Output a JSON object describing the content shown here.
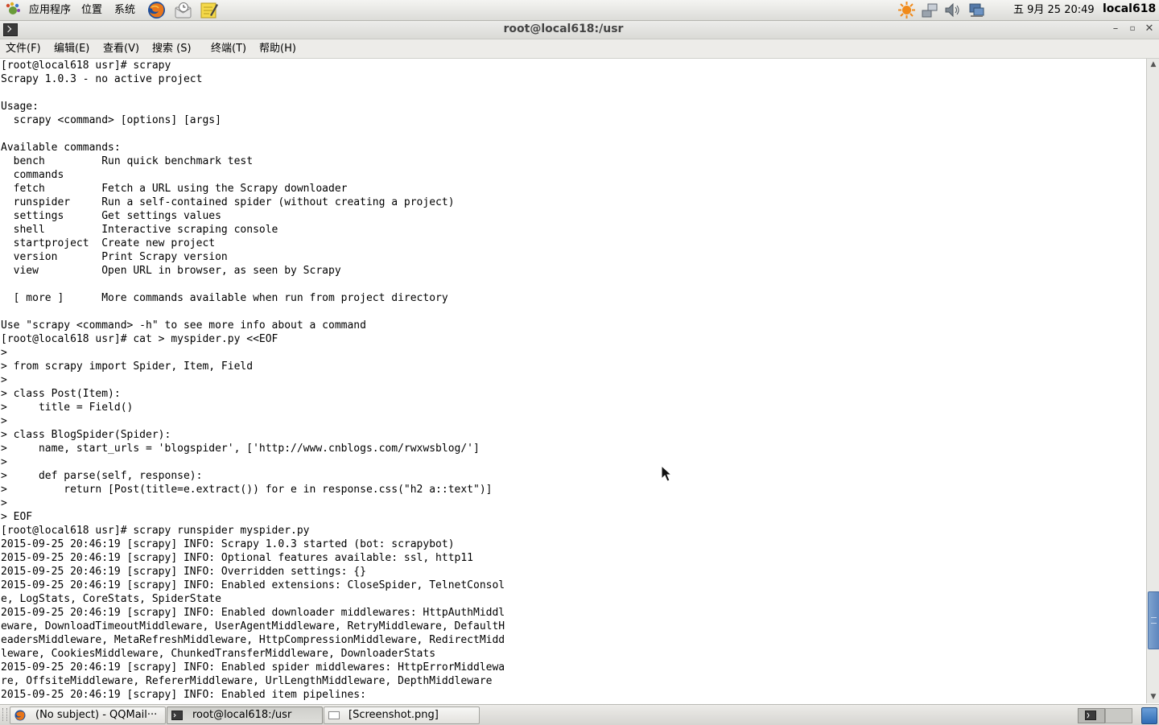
{
  "top_panel": {
    "menus": [
      "应用程序",
      "位置",
      "系统"
    ],
    "launchers": [
      "firefox-icon",
      "mail-clock-icon",
      "notes-icon"
    ],
    "tray_icons": [
      "update-icon",
      "network-icon",
      "volume-icon",
      "display-icon"
    ],
    "clock": "五 9月 25 20:49",
    "hostname": "local618"
  },
  "window": {
    "title": "root@local618:/usr",
    "menu": [
      "文件(F)",
      "编辑(E)",
      "查看(V)",
      "搜索 (S)",
      "终端(T)",
      "帮助(H)"
    ]
  },
  "terminal": {
    "lines": [
      "[root@local618 usr]# scrapy",
      "Scrapy 1.0.3 - no active project",
      "",
      "Usage:",
      "  scrapy <command> [options] [args]",
      "",
      "Available commands:",
      "  bench         Run quick benchmark test",
      "  commands",
      "  fetch         Fetch a URL using the Scrapy downloader",
      "  runspider     Run a self-contained spider (without creating a project)",
      "  settings      Get settings values",
      "  shell         Interactive scraping console",
      "  startproject  Create new project",
      "  version       Print Scrapy version",
      "  view          Open URL in browser, as seen by Scrapy",
      "",
      "  [ more ]      More commands available when run from project directory",
      "",
      "Use \"scrapy <command> -h\" to see more info about a command",
      "[root@local618 usr]# cat > myspider.py <<EOF",
      ">",
      "> from scrapy import Spider, Item, Field",
      ">",
      "> class Post(Item):",
      ">     title = Field()",
      ">",
      "> class BlogSpider(Spider):",
      ">     name, start_urls = 'blogspider', ['http://www.cnblogs.com/rwxwsblog/']",
      ">",
      ">     def parse(self, response):",
      ">         return [Post(title=e.extract()) for e in response.css(\"h2 a::text\")]",
      ">",
      "> EOF",
      "[root@local618 usr]# scrapy runspider myspider.py",
      "2015-09-25 20:46:19 [scrapy] INFO: Scrapy 1.0.3 started (bot: scrapybot)",
      "2015-09-25 20:46:19 [scrapy] INFO: Optional features available: ssl, http11",
      "2015-09-25 20:46:19 [scrapy] INFO: Overridden settings: {}",
      "2015-09-25 20:46:19 [scrapy] INFO: Enabled extensions: CloseSpider, TelnetConsol",
      "e, LogStats, CoreStats, SpiderState",
      "2015-09-25 20:46:19 [scrapy] INFO: Enabled downloader middlewares: HttpAuthMiddl",
      "eware, DownloadTimeoutMiddleware, UserAgentMiddleware, RetryMiddleware, DefaultH",
      "eadersMiddleware, MetaRefreshMiddleware, HttpCompressionMiddleware, RedirectMidd",
      "leware, CookiesMiddleware, ChunkedTransferMiddleware, DownloaderStats",
      "2015-09-25 20:46:19 [scrapy] INFO: Enabled spider middlewares: HttpErrorMiddlewa",
      "re, OffsiteMiddleware, RefererMiddleware, UrlLengthMiddleware, DepthMiddleware",
      "2015-09-25 20:46:19 [scrapy] INFO: Enabled item pipelines:"
    ]
  },
  "taskbar": {
    "tasks": [
      {
        "label": "(No subject) - QQMail···",
        "icon": "firefox-icon",
        "active": false
      },
      {
        "label": "root@local618:/usr",
        "icon": "terminal-icon",
        "active": true
      },
      {
        "label": "[Screenshot.png]",
        "icon": "image-icon",
        "active": false
      }
    ]
  }
}
